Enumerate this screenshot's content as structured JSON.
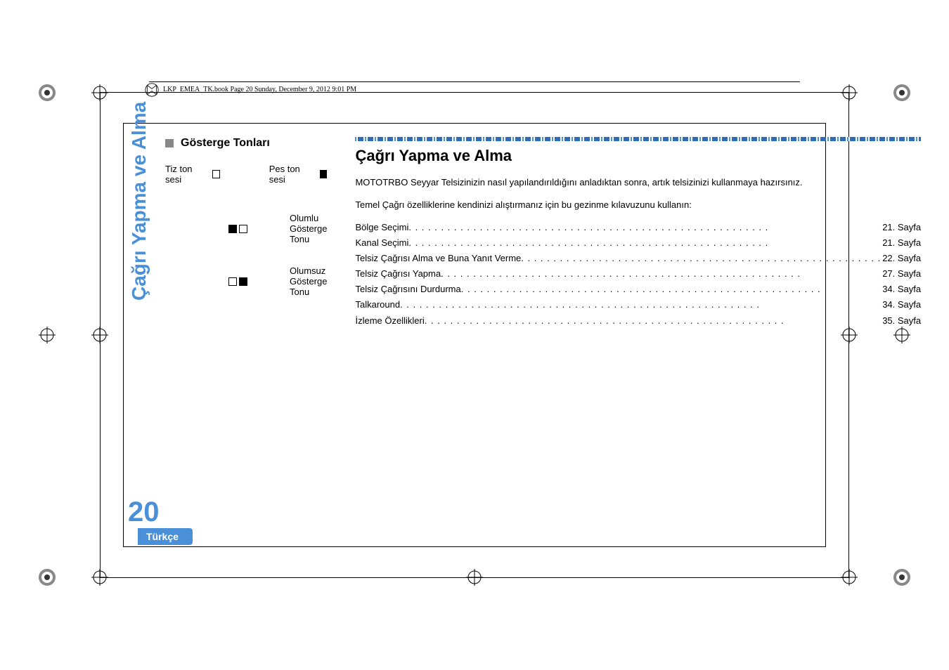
{
  "header": {
    "text": "LKP_EMEA_TK.book  Page 20  Sunday, December 9, 2012  9:01 PM"
  },
  "left": {
    "section_title": "Gösterge Tonları",
    "high_tone_label": "Tiz ton sesi",
    "low_tone_label": "Pes ton sesi",
    "positive_label": "Olumlu Gösterge Tonu",
    "negative_label": "Olumsuz Gösterge Tonu"
  },
  "right": {
    "heading": "Çağrı Yapma ve Alma",
    "para1": "MOTOTRBO Seyyar Telsizinizin nasıl yapılandırıldığını anladıktan sonra, artık telsizinizi kullanmaya hazırsınız.",
    "para2": "Temel Çağrı özelliklerine kendinizi alıştırmanız için bu gezinme kılavuzunu kullanın:",
    "toc": [
      {
        "label": "Bölge Seçimi",
        "page": "21. Sayfa"
      },
      {
        "label": "Kanal Seçimi",
        "page": "21. Sayfa"
      },
      {
        "label": "Telsiz Çağrısı Alma ve Buna Yanıt Verme",
        "page": "22. Sayfa"
      },
      {
        "label": "Telsiz Çağrısı Yapma",
        "page": "27. Sayfa"
      },
      {
        "label": "Telsiz Çağrısını Durdurma",
        "page": "34. Sayfa"
      },
      {
        "label": "Talkaround",
        "page": "34. Sayfa"
      },
      {
        "label": "İzleme Özellikleri",
        "page": "35. Sayfa"
      }
    ]
  },
  "sidebar": {
    "tab_text": "Çağrı Yapma ve Alma",
    "page_num": "20",
    "lang": "Türkçe"
  }
}
